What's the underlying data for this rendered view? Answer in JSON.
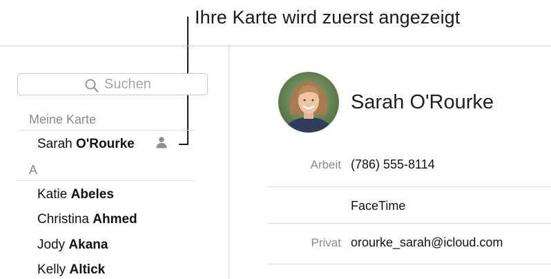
{
  "callout": {
    "text": "Ihre Karte wird zuerst angezeigt"
  },
  "sidebar": {
    "search_placeholder": "Suchen",
    "my_card_header": "Meine Karte",
    "my_card_name_first": "Sarah ",
    "my_card_name_last": "O'Rourke",
    "section_letter": "A",
    "contacts": [
      {
        "first": "Katie ",
        "last": "Abeles"
      },
      {
        "first": "Christina ",
        "last": "Ahmed"
      },
      {
        "first": "Jody ",
        "last": "Akana"
      },
      {
        "first": "Kelly ",
        "last": "Altick"
      }
    ]
  },
  "detail": {
    "name": "Sarah O'Rourke",
    "fields": [
      {
        "label": "Arbeit",
        "value": "(786) 555-8114"
      },
      {
        "label": "",
        "value": "FaceTime"
      },
      {
        "label": "Privat",
        "value": "orourke_sarah@icloud.com"
      }
    ]
  },
  "icons": {
    "search": "search-icon",
    "my_card": "person-icon"
  }
}
